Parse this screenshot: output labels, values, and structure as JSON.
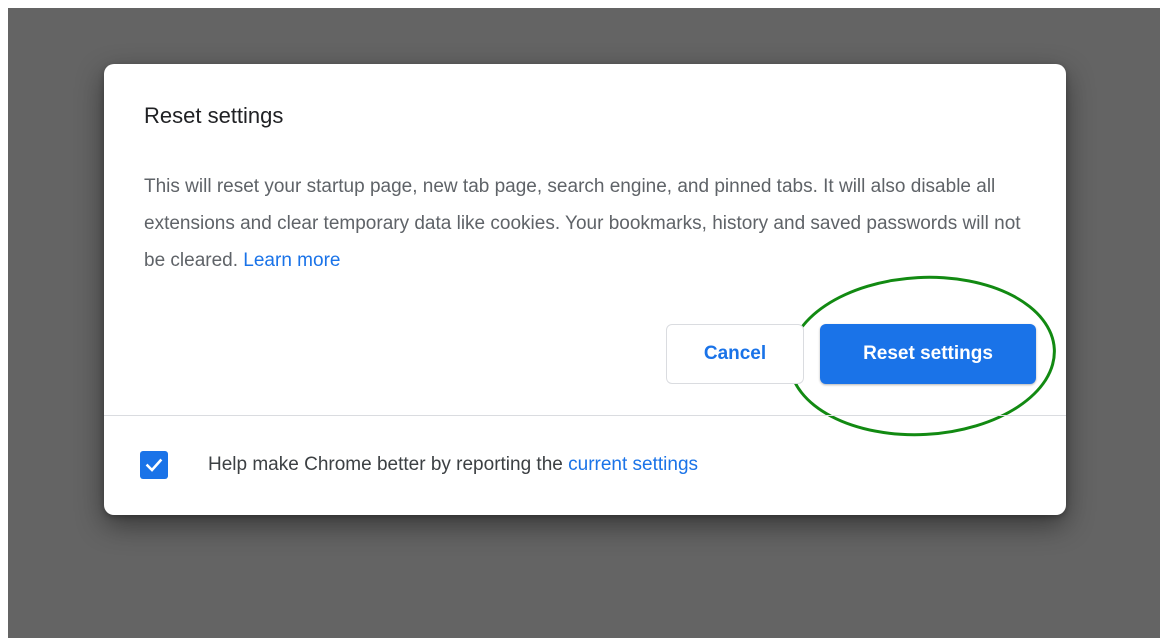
{
  "dialog": {
    "title": "Reset settings",
    "body_text": "This will reset your startup page, new tab page, search engine, and pinned tabs. It will also disable all extensions and clear temporary data like cookies. Your bookmarks, history and saved passwords will not be cleared. ",
    "learn_more_link": "Learn more",
    "cancel_label": "Cancel",
    "reset_label": "Reset settings"
  },
  "footer": {
    "checkbox_checked": true,
    "text": "Help make Chrome better by reporting the ",
    "link": "current settings"
  },
  "colors": {
    "overlay": "#646464",
    "accent": "#1a73e8",
    "highlight_annotation": "#128a12"
  },
  "icons": {
    "checkbox": "check-icon"
  }
}
